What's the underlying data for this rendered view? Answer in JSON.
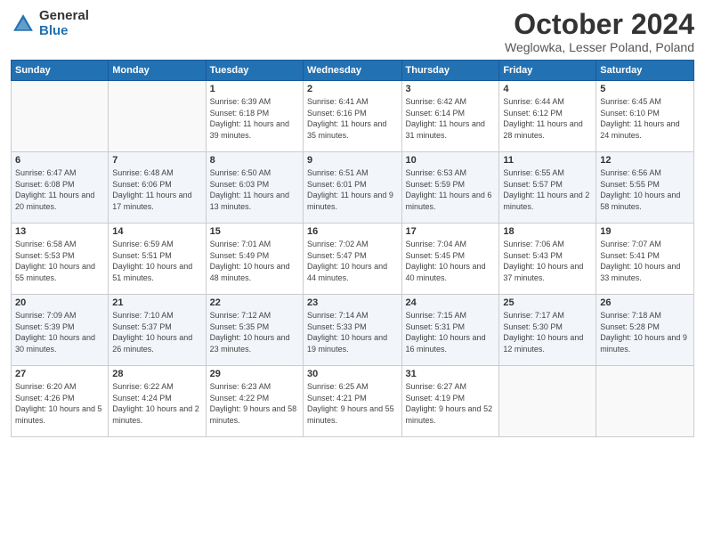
{
  "logo": {
    "general": "General",
    "blue": "Blue"
  },
  "title": "October 2024",
  "subtitle": "Weglowka, Lesser Poland, Poland",
  "days_of_week": [
    "Sunday",
    "Monday",
    "Tuesday",
    "Wednesday",
    "Thursday",
    "Friday",
    "Saturday"
  ],
  "weeks": [
    [
      {
        "day": "",
        "info": ""
      },
      {
        "day": "",
        "info": ""
      },
      {
        "day": "1",
        "info": "Sunrise: 6:39 AM\nSunset: 6:18 PM\nDaylight: 11 hours and 39 minutes."
      },
      {
        "day": "2",
        "info": "Sunrise: 6:41 AM\nSunset: 6:16 PM\nDaylight: 11 hours and 35 minutes."
      },
      {
        "day": "3",
        "info": "Sunrise: 6:42 AM\nSunset: 6:14 PM\nDaylight: 11 hours and 31 minutes."
      },
      {
        "day": "4",
        "info": "Sunrise: 6:44 AM\nSunset: 6:12 PM\nDaylight: 11 hours and 28 minutes."
      },
      {
        "day": "5",
        "info": "Sunrise: 6:45 AM\nSunset: 6:10 PM\nDaylight: 11 hours and 24 minutes."
      }
    ],
    [
      {
        "day": "6",
        "info": "Sunrise: 6:47 AM\nSunset: 6:08 PM\nDaylight: 11 hours and 20 minutes."
      },
      {
        "day": "7",
        "info": "Sunrise: 6:48 AM\nSunset: 6:06 PM\nDaylight: 11 hours and 17 minutes."
      },
      {
        "day": "8",
        "info": "Sunrise: 6:50 AM\nSunset: 6:03 PM\nDaylight: 11 hours and 13 minutes."
      },
      {
        "day": "9",
        "info": "Sunrise: 6:51 AM\nSunset: 6:01 PM\nDaylight: 11 hours and 9 minutes."
      },
      {
        "day": "10",
        "info": "Sunrise: 6:53 AM\nSunset: 5:59 PM\nDaylight: 11 hours and 6 minutes."
      },
      {
        "day": "11",
        "info": "Sunrise: 6:55 AM\nSunset: 5:57 PM\nDaylight: 11 hours and 2 minutes."
      },
      {
        "day": "12",
        "info": "Sunrise: 6:56 AM\nSunset: 5:55 PM\nDaylight: 10 hours and 58 minutes."
      }
    ],
    [
      {
        "day": "13",
        "info": "Sunrise: 6:58 AM\nSunset: 5:53 PM\nDaylight: 10 hours and 55 minutes."
      },
      {
        "day": "14",
        "info": "Sunrise: 6:59 AM\nSunset: 5:51 PM\nDaylight: 10 hours and 51 minutes."
      },
      {
        "day": "15",
        "info": "Sunrise: 7:01 AM\nSunset: 5:49 PM\nDaylight: 10 hours and 48 minutes."
      },
      {
        "day": "16",
        "info": "Sunrise: 7:02 AM\nSunset: 5:47 PM\nDaylight: 10 hours and 44 minutes."
      },
      {
        "day": "17",
        "info": "Sunrise: 7:04 AM\nSunset: 5:45 PM\nDaylight: 10 hours and 40 minutes."
      },
      {
        "day": "18",
        "info": "Sunrise: 7:06 AM\nSunset: 5:43 PM\nDaylight: 10 hours and 37 minutes."
      },
      {
        "day": "19",
        "info": "Sunrise: 7:07 AM\nSunset: 5:41 PM\nDaylight: 10 hours and 33 minutes."
      }
    ],
    [
      {
        "day": "20",
        "info": "Sunrise: 7:09 AM\nSunset: 5:39 PM\nDaylight: 10 hours and 30 minutes."
      },
      {
        "day": "21",
        "info": "Sunrise: 7:10 AM\nSunset: 5:37 PM\nDaylight: 10 hours and 26 minutes."
      },
      {
        "day": "22",
        "info": "Sunrise: 7:12 AM\nSunset: 5:35 PM\nDaylight: 10 hours and 23 minutes."
      },
      {
        "day": "23",
        "info": "Sunrise: 7:14 AM\nSunset: 5:33 PM\nDaylight: 10 hours and 19 minutes."
      },
      {
        "day": "24",
        "info": "Sunrise: 7:15 AM\nSunset: 5:31 PM\nDaylight: 10 hours and 16 minutes."
      },
      {
        "day": "25",
        "info": "Sunrise: 7:17 AM\nSunset: 5:30 PM\nDaylight: 10 hours and 12 minutes."
      },
      {
        "day": "26",
        "info": "Sunrise: 7:18 AM\nSunset: 5:28 PM\nDaylight: 10 hours and 9 minutes."
      }
    ],
    [
      {
        "day": "27",
        "info": "Sunrise: 6:20 AM\nSunset: 4:26 PM\nDaylight: 10 hours and 5 minutes."
      },
      {
        "day": "28",
        "info": "Sunrise: 6:22 AM\nSunset: 4:24 PM\nDaylight: 10 hours and 2 minutes."
      },
      {
        "day": "29",
        "info": "Sunrise: 6:23 AM\nSunset: 4:22 PM\nDaylight: 9 hours and 58 minutes."
      },
      {
        "day": "30",
        "info": "Sunrise: 6:25 AM\nSunset: 4:21 PM\nDaylight: 9 hours and 55 minutes."
      },
      {
        "day": "31",
        "info": "Sunrise: 6:27 AM\nSunset: 4:19 PM\nDaylight: 9 hours and 52 minutes."
      },
      {
        "day": "",
        "info": ""
      },
      {
        "day": "",
        "info": ""
      }
    ]
  ]
}
